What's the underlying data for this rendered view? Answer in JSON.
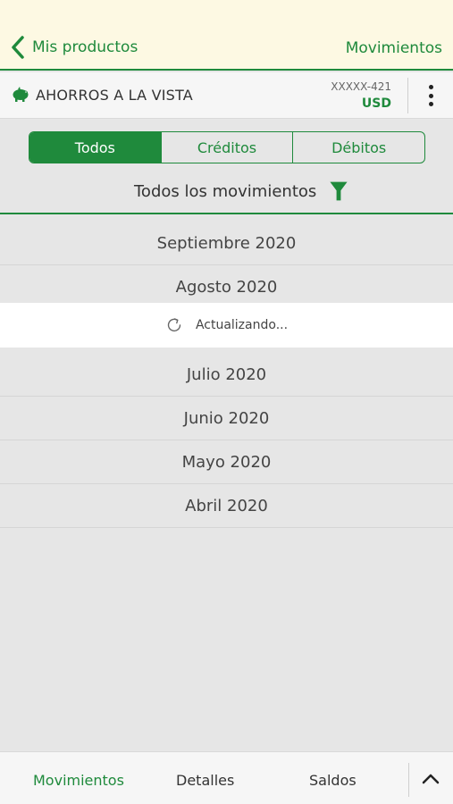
{
  "header": {
    "back_label": "Mis productos",
    "title_right": "Movimientos"
  },
  "account": {
    "name": "AHORROS A LA VISTA",
    "number": "XXXXX-421",
    "currency": "USD",
    "icon": "piggy-bank-icon"
  },
  "segments": [
    {
      "label": "Todos",
      "active": true
    },
    {
      "label": "Créditos",
      "active": false
    },
    {
      "label": "Débitos",
      "active": false
    }
  ],
  "filter": {
    "label": "Todos los movimientos",
    "icon": "filter-icon"
  },
  "months": [
    "Septiembre 2020",
    "Agosto 2020",
    "Julio 2020",
    "Junio 2020",
    "Mayo 2020",
    "Abril 2020"
  ],
  "loading": {
    "text": "Actualizando...",
    "icon": "refresh-icon"
  },
  "bottom_tabs": [
    {
      "label": "Movimientos",
      "active": true
    },
    {
      "label": "Detalles",
      "active": false
    },
    {
      "label": "Saldos",
      "active": false
    }
  ],
  "colors": {
    "accent": "#1f8a3c",
    "header_bg": "#fdf9e3",
    "list_bg": "#e6e6e6"
  }
}
